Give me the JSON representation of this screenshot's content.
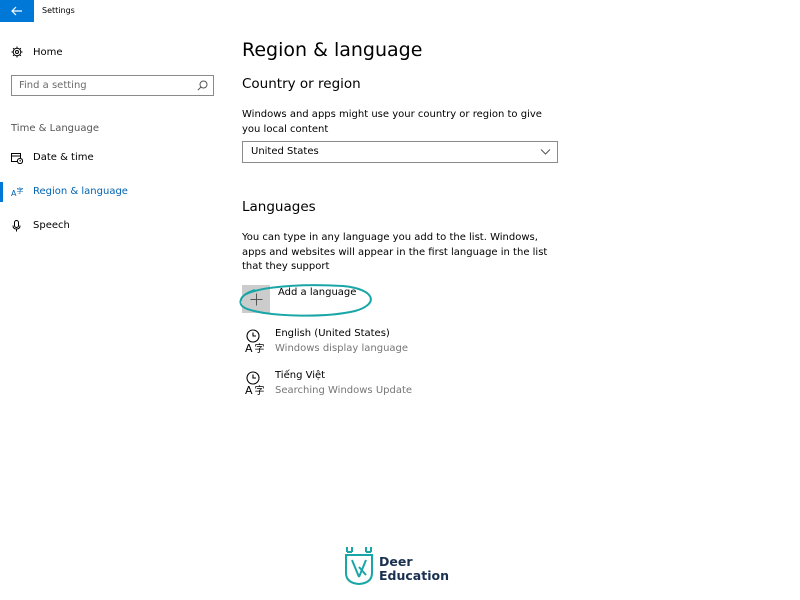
{
  "window": {
    "title": "Settings"
  },
  "sidebar": {
    "home_label": "Home",
    "search_placeholder": "Find a setting",
    "section_header": "Time & Language",
    "items": [
      {
        "label": "Date & time",
        "icon": "calendar-clock-icon"
      },
      {
        "label": "Region & language",
        "icon": "region-language-icon",
        "active": true
      },
      {
        "label": "Speech",
        "icon": "microphone-icon"
      }
    ]
  },
  "main": {
    "page_title": "Region & language",
    "country": {
      "title": "Country or region",
      "description": "Windows and apps might use your country or region to give you local content",
      "selected": "United States"
    },
    "languages": {
      "title": "Languages",
      "description": "You can type in any language you add to the list. Windows, apps and websites will appear in the first language in the list that they support",
      "add_label": "Add a language",
      "list": [
        {
          "name": "English (United States)",
          "status": "Windows display language"
        },
        {
          "name": "Tiếng Việt",
          "status": "Searching Windows Update"
        }
      ]
    }
  },
  "watermark": {
    "line1": "Deer",
    "line2": "Education"
  },
  "colors": {
    "accent": "#0078d7",
    "highlight_ellipse": "#1aa6a6",
    "logo": "#1a3050"
  }
}
